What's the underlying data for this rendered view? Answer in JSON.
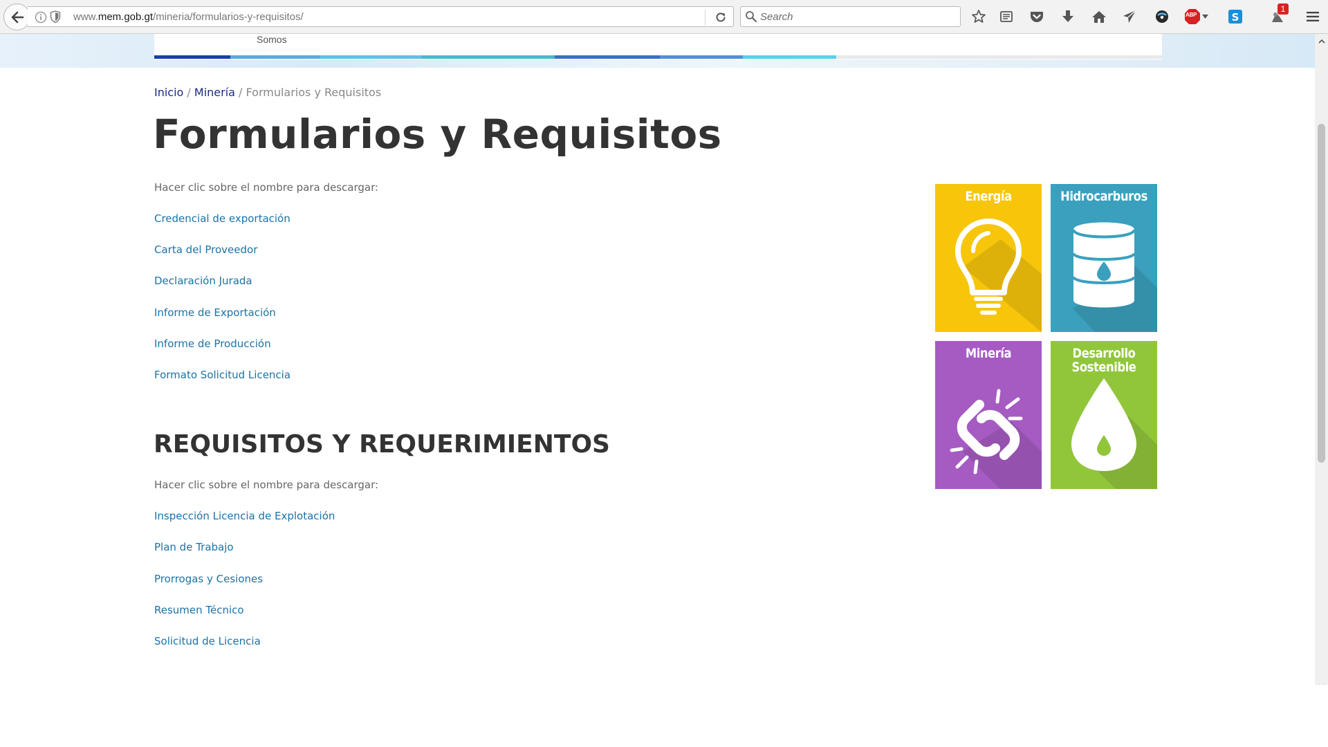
{
  "browser": {
    "url_prefix": "www.",
    "url_host": "mem.gob.gt",
    "url_path": "/mineria/formularios-y-requisitos/",
    "search_placeholder": "Search",
    "notification_count": "1",
    "adblock_label": "ABP",
    "icons": [
      "back-arrow-icon",
      "info-icon",
      "shield-icon",
      "reload-icon",
      "search-icon",
      "star-icon",
      "reading-list-icon",
      "pocket-icon",
      "download-icon",
      "home-icon",
      "send-icon",
      "disk-icon",
      "adblock-icon",
      "skype-icon",
      "notification-icon",
      "menu-icon"
    ]
  },
  "header": {
    "nav_somos": "Somos",
    "color_bar": [
      "#1a3fa8",
      "#5aaadf",
      "#5cc2e6",
      "#49b9c9",
      "#3a6fc6",
      "#4f8fd9",
      "#59d0ee",
      "#e9e9e9"
    ]
  },
  "breadcrumb": {
    "home": "Inicio",
    "sep1": " / ",
    "section": "Minería",
    "sep2": " / ",
    "current": "Formularios y Requisitos"
  },
  "page": {
    "title": "Formularios y Requisitos",
    "intro": "Hacer clic sobre el nombre para descargar:",
    "forms": [
      "Credencial de exportación",
      "Carta del Proveedor",
      "Declaración Jurada",
      "Informe de Exportación",
      "Informe de Producción",
      "Formato Solicitud Licencia"
    ],
    "section_title": "REQUISITOS Y REQUERIMIENTOS",
    "section_intro": "Hacer clic sobre el nombre para descargar:",
    "requirements": [
      "Inspección Licencia de Explotación",
      "Plan de Trabajo",
      "Prorrogas y Cesiones",
      "Resumen Técnico",
      "Solicitud de Licencia"
    ]
  },
  "tiles": [
    {
      "label": "Energía",
      "color": "#f7c60b",
      "icon": "lightbulb-icon"
    },
    {
      "label": "Hidrocarburos",
      "color": "#3aa0bd",
      "icon": "oil-barrel-icon"
    },
    {
      "label": "Minería",
      "color": "#a55bc2",
      "icon": "broken-chain-icon"
    },
    {
      "label": "Desarrollo Sostenible",
      "color": "#91c63b",
      "icon": "water-drop-icon"
    }
  ]
}
